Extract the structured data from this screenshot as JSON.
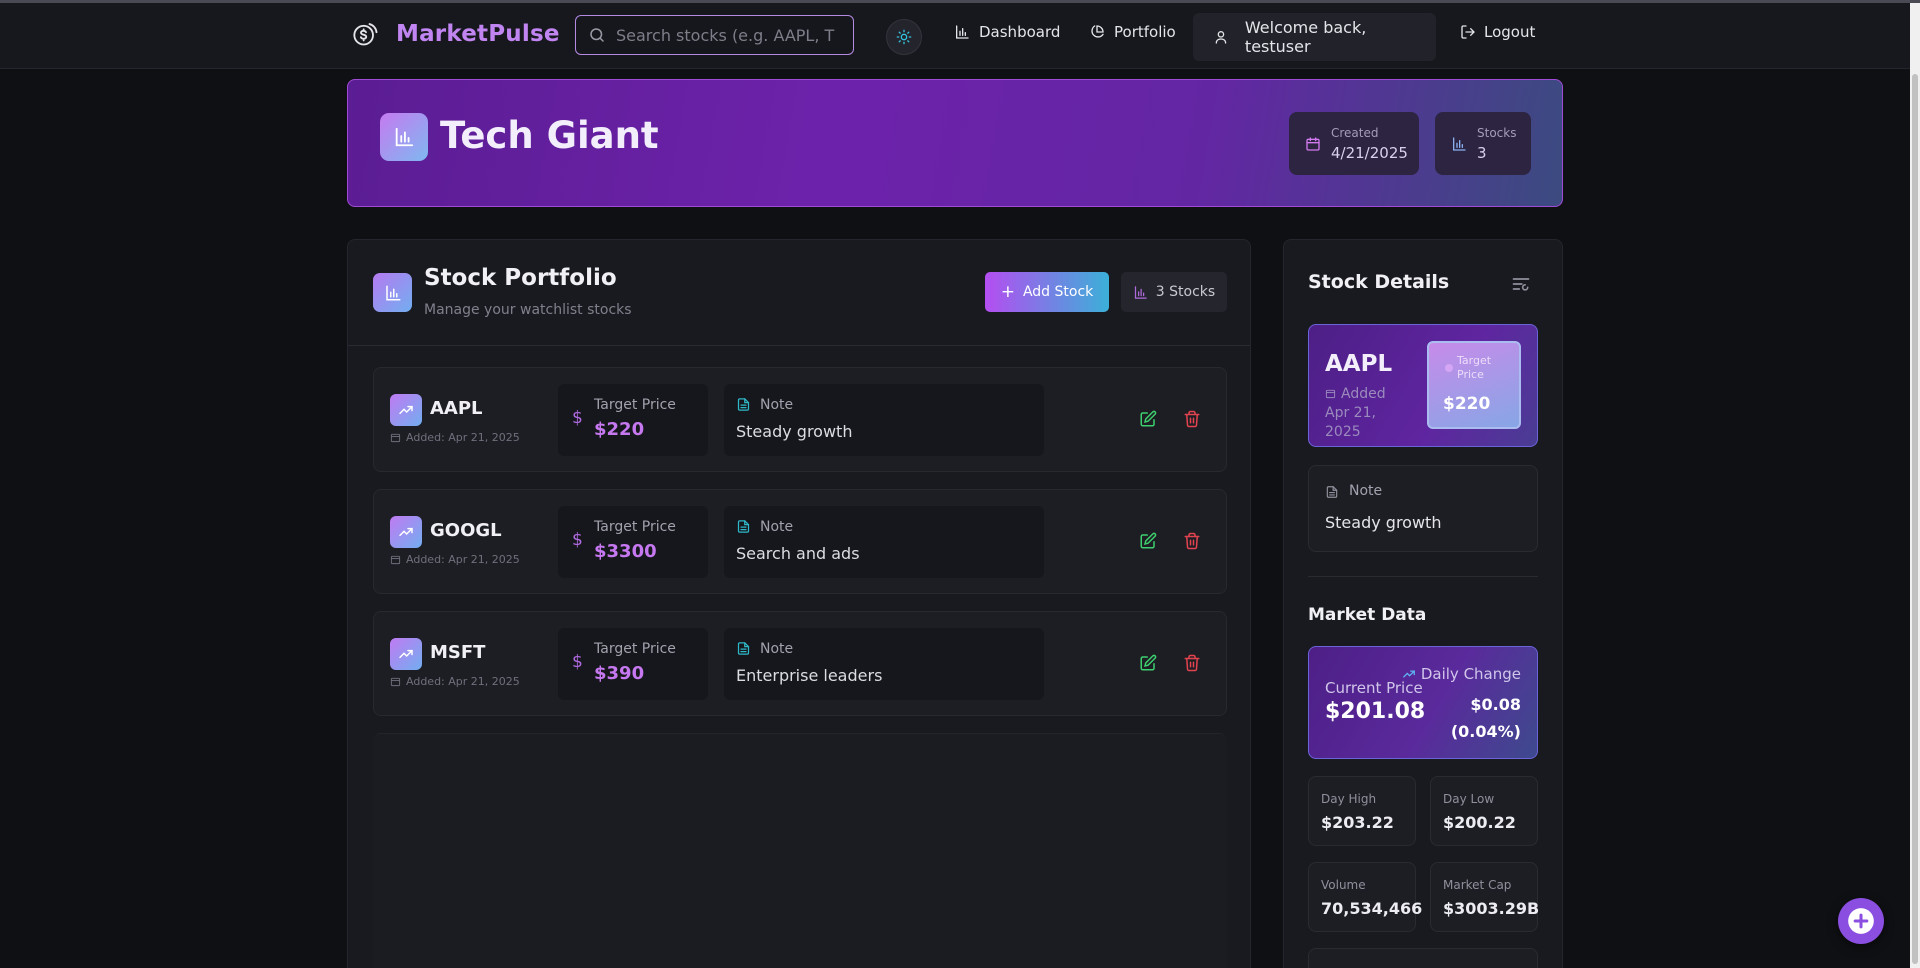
{
  "navbar": {
    "brand": "MarketPulse",
    "search_placeholder": "Search stocks (e.g. AAPL, T",
    "dashboard_label": "Dashboard",
    "portfolio_label": "Portfolio",
    "welcome_text": "Welcome back, testuser",
    "logout_label": "Logout"
  },
  "hero": {
    "title": "Tech Giant",
    "created_label": "Created",
    "created_value": "4/21/2025",
    "stocks_label": "Stocks",
    "stocks_value": "3"
  },
  "portfolio": {
    "title": "Stock Portfolio",
    "subtitle": "Manage your watchlist stocks",
    "add_button": "Add Stock",
    "count_label": "3 Stocks",
    "target_label": "Target Price",
    "note_label": "Note",
    "stocks": [
      {
        "symbol": "AAPL",
        "added": "Added: Apr 21, 2025",
        "target": "$220",
        "note": "Steady growth"
      },
      {
        "symbol": "GOOGL",
        "added": "Added: Apr 21, 2025",
        "target": "$3300",
        "note": "Search and ads"
      },
      {
        "symbol": "MSFT",
        "added": "Added: Apr 21, 2025",
        "target": "$390",
        "note": "Enterprise leaders"
      }
    ]
  },
  "details": {
    "title": "Stock Details",
    "symbol": "AAPL",
    "added": "Added Apr 21, 2025",
    "target_label": "Target Price",
    "target_value": "$220",
    "note_label": "Note",
    "note_value": "Steady growth",
    "market_title": "Market Data",
    "current_price_label": "Current Price",
    "current_price": "$201.08",
    "daily_change_label": "Daily Change",
    "daily_change": "$0.08 (0.04%)",
    "day_high_label": "Day High",
    "day_high": "$203.22",
    "day_low_label": "Day Low",
    "day_low": "$200.22",
    "volume_label": "Volume",
    "volume": "70,534,466",
    "market_cap_label": "Market Cap",
    "market_cap": "$3003.29B"
  },
  "colors": {
    "accent": "#c185f2",
    "gradient_start": "#b44ef0",
    "gradient_end": "#3bb0d8",
    "edit": "#3ecf6e",
    "delete": "#e2434f"
  },
  "icons": {
    "brand": "dollar-coin-icon",
    "search": "search-icon",
    "theme": "sun-icon",
    "dashboard": "bar-chart-icon",
    "portfolio": "pie-chart-icon",
    "user": "user-icon",
    "logout": "logout-icon",
    "add": "plus-icon",
    "trend": "trending-up-icon",
    "edit": "edit-icon",
    "delete": "trash-icon",
    "note": "file-text-icon",
    "calendar": "calendar-icon"
  }
}
